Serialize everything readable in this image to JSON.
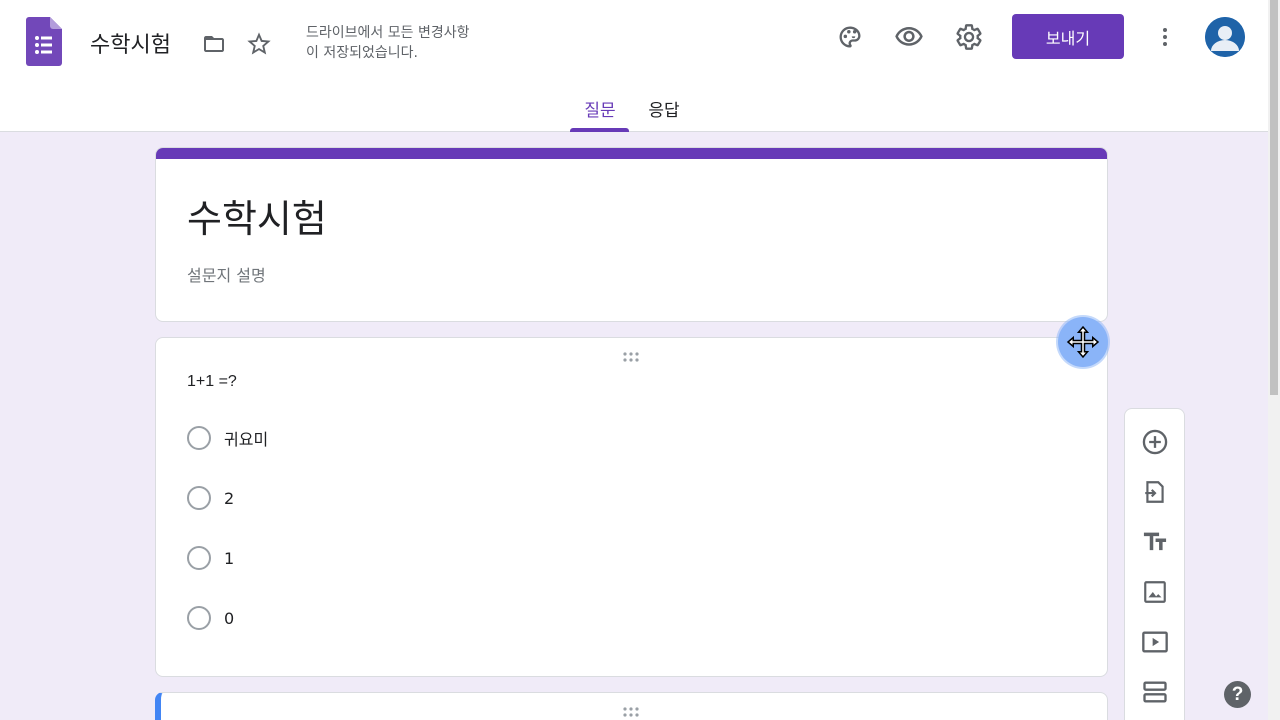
{
  "header": {
    "doc_title": "수학시험",
    "save_status_line1": "드라이브에서 모든 변경사항",
    "save_status_line2": "이 저장되었습니다.",
    "send_label": "보내기"
  },
  "tabs": [
    {
      "label": "질문",
      "active": true
    },
    {
      "label": "응답",
      "active": false
    }
  ],
  "form": {
    "title": "수학시험",
    "description_placeholder": "설문지 설명"
  },
  "question": {
    "title": "1+1 =?",
    "options": [
      "귀요미",
      "2",
      "1",
      "0"
    ]
  },
  "help_label": "?",
  "colors": {
    "accent": "#673ab7",
    "background": "#f0ebf8",
    "active_card": "#4285f4"
  }
}
